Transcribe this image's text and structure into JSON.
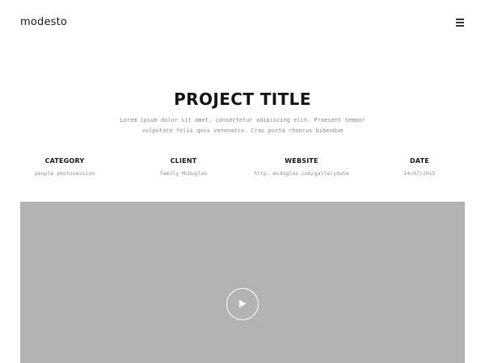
{
  "header": {
    "logo": "modesto",
    "menu_icon": "hamburger-menu-icon"
  },
  "hero": {
    "title": "PROJECT TITLE",
    "description_lines": [
      "Lorem ipsum dolor sit amet, consectetur adipiscing elit. Praesent tempor",
      "vulputate felis quis venenatis. Cras porta rhoncus bibendum"
    ]
  },
  "meta": {
    "category": {
      "label": "CATEGORY",
      "value": "people photosession"
    },
    "client": {
      "label": "CLIENT",
      "value": "family McDuglas"
    },
    "website": {
      "label": "WEBSITE",
      "value": "http: mcduglas.com/gallerydate"
    },
    "date": {
      "label": "DATE",
      "value": "14/07/2015"
    }
  },
  "video": {
    "placeholder_color": "#b3b3b3",
    "play_icon": "play-icon"
  }
}
